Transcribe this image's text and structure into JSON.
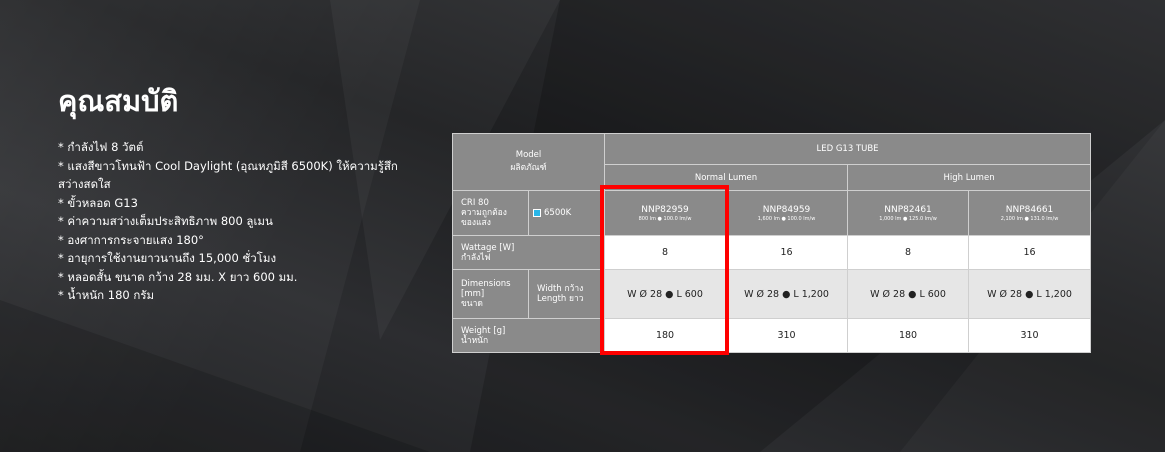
{
  "title": "คุณสมบัติ",
  "features": [
    "* กำลังไฟ 8 วัตต์",
    "* แสงสีขาวโทนฟ้า Cool Daylight (อุณหภูมิสี 6500K) ให้ความรู้สึกสว่างสดใส",
    "* ขั้วหลอด G13",
    "* ค่าความสว่างเต็มประสิทธิภาพ 800 ลูเมน",
    "* องศาการกระจายแสง 180°",
    "* อายุการใช้งานยาวนานถึง 15,000 ชั่วโมง",
    "* หลอดสั้น ขนาด กว้าง 28 มม. X ยาว 600 มม.",
    "* น้ำหนัก 180 กรัม"
  ],
  "spec": {
    "model_label": "Model",
    "model_label_th": "ผลิตภัณฑ์",
    "product_header": "LED G13 TUBE",
    "groups": [
      "Normal Lumen",
      "High Lumen"
    ],
    "cri_label": "CRI 80",
    "cri_label_th": "ความถูกต้อง",
    "cri_label_th2": "ของแสง",
    "color_temp": "6500K",
    "models": [
      {
        "code": "NNP82959",
        "sub": "800 lm ● 100.0 lm/w",
        "wattage": "8",
        "dimension": "W Ø 28 ● L 600",
        "weight": "180"
      },
      {
        "code": "NNP84959",
        "sub": "1,600 lm ● 100.0 lm/w",
        "wattage": "16",
        "dimension": "W Ø 28 ● L 1,200",
        "weight": "310"
      },
      {
        "code": "NNP82461",
        "sub": "1,000 lm ● 125.0 lm/w",
        "wattage": "8",
        "dimension": "W Ø 28 ● L 600",
        "weight": "180"
      },
      {
        "code": "NNP84661",
        "sub": "2,100 lm ● 131.0 lm/w",
        "wattage": "16",
        "dimension": "W Ø 28 ● L 1,200",
        "weight": "310"
      }
    ],
    "wattage_label": "Wattage [W]",
    "wattage_label_th": "กำลังไฟ",
    "dim_label": "Dimensions",
    "dim_label_unit": "[mm]",
    "dim_label_th": "ขนาด",
    "width_label": "Width กว้าง",
    "length_label": "Length ยาว",
    "weight_label": "Weight [g]",
    "weight_label_th": "น้ำหนัก"
  },
  "colors": {
    "background": "#262729",
    "table_gray": "#8a8a8a",
    "highlight": "#ff0000",
    "swatch": "#29b6e8"
  }
}
